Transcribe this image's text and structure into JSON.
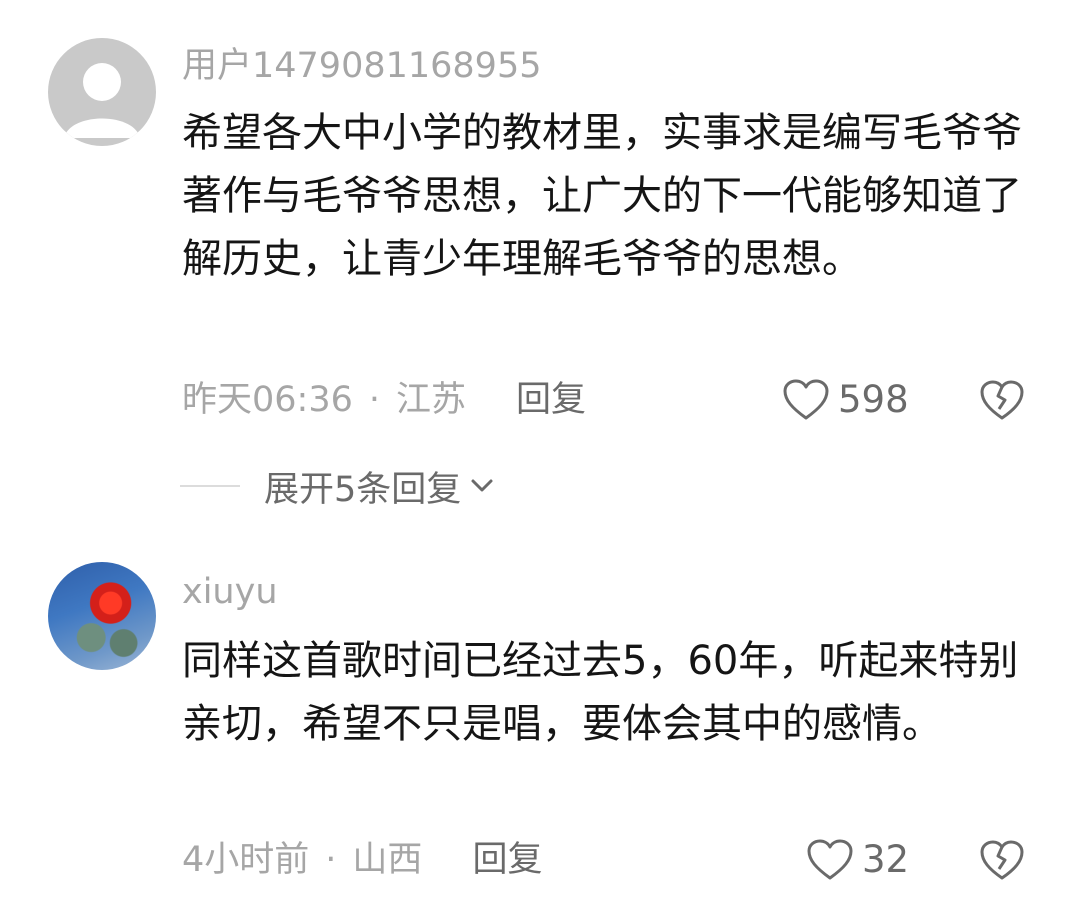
{
  "comments": [
    {
      "username": "用户1479081168955",
      "text": "希望各大中小学的教材里，实事求是编写毛爷爷著作与毛爷爷思想，让广大的下一代能够知道了解历史，让青少年理解毛爷爷的思想。",
      "time": "昨天06:36",
      "separator": "·",
      "location": "江苏",
      "reply_label": "回复",
      "likes": "598"
    },
    {
      "username": "xiuyu",
      "text": "同样这首歌时间已经过去5，60年，听起来特别亲切，希望不只是唱，要体会其中的感情。",
      "time": "4小时前",
      "separator": "·",
      "location": "山西",
      "reply_label": "回复",
      "likes": "32"
    }
  ],
  "expand_replies": {
    "label": "展开5条回复"
  },
  "icons": {
    "like": "heart-outline-icon",
    "dislike": "broken-heart-icon",
    "expand": "chevron-down-icon",
    "avatar_default": "default-user-icon"
  },
  "colors": {
    "meta": "#a6a6a6",
    "text": "#151515",
    "action": "#6a6a6a"
  }
}
